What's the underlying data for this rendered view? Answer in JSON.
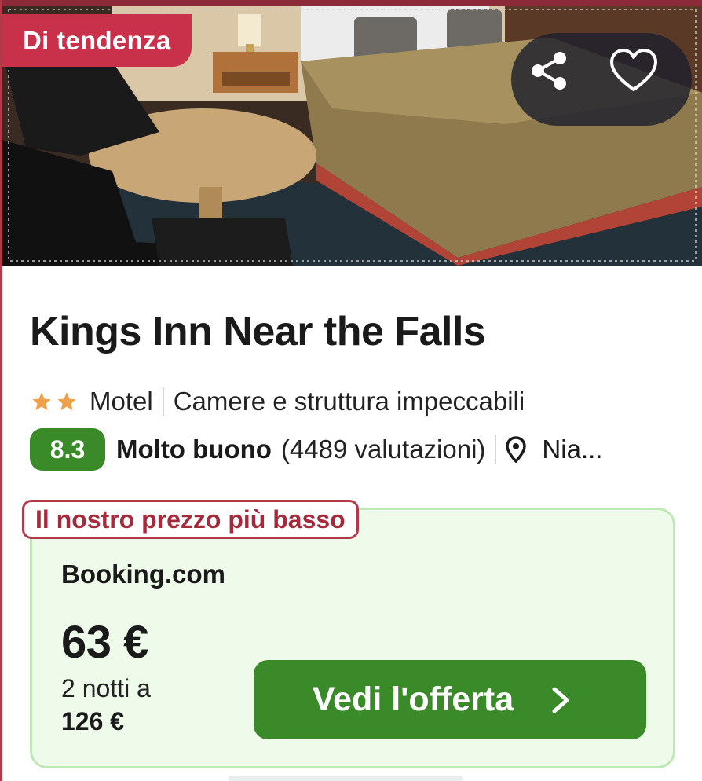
{
  "badge": {
    "trending": "Di tendenza"
  },
  "hotel": {
    "name": "Kings Inn Near the Falls",
    "stars": 2,
    "type": "Motel",
    "highlight": "Camere e struttura impeccabili",
    "score": "8.3",
    "rating_label": "Molto buono",
    "reviews": "(4489 valutazioni)",
    "location": "Nia..."
  },
  "deal": {
    "badge": "Il nostro prezzo più basso",
    "provider": "Booking.com",
    "price": "63 €",
    "nights": "2 notti a",
    "total": "126 €",
    "cta": "Vedi l'offerta"
  },
  "icons": {
    "share": "share-icon",
    "favorite": "heart-icon",
    "location": "map-pin-icon",
    "cta_arrow": "chevron-right-icon",
    "star": "star-icon"
  },
  "colors": {
    "brand_red": "#c9314a",
    "score_green": "#3b8a2a",
    "cta_green": "#3b8a2a",
    "deal_bg": "#eefbea",
    "star_orange": "#f0a04b"
  }
}
